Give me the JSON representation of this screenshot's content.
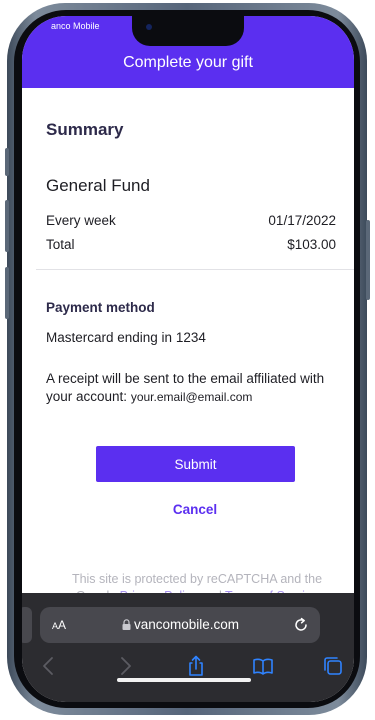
{
  "status_bar": {
    "app_name": "anco Mobile"
  },
  "header": {
    "title": "Complete your gift"
  },
  "summary": {
    "title": "Summary",
    "fund_name": "General Fund",
    "frequency_label": "Every week",
    "date": "01/17/2022",
    "total_label": "Total",
    "total_value": "$103.00"
  },
  "payment": {
    "title": "Payment method",
    "card_text": "Mastercard ending in 1234",
    "receipt_text": "A receipt will be sent to the email affiliated with your account:",
    "email": "your.email@email.com"
  },
  "actions": {
    "submit_label": "Submit",
    "cancel_label": "Cancel"
  },
  "recaptcha": {
    "text_before": "This site is protected by reCAPTCHA and the Google",
    "privacy_label": "Privacy Policy",
    "text_and": "and",
    "terms_label": "Terms of Service"
  },
  "browser": {
    "aa_small": "A",
    "aa_large": "A",
    "url": "vancomobile.com"
  },
  "icons": [
    "lock-icon",
    "reload-icon",
    "back-icon",
    "forward-icon",
    "share-icon",
    "bookmarks-icon",
    "tabs-icon"
  ],
  "colors": {
    "brand_purple": "#5b2ff0",
    "toolbar": "#2c2c30",
    "text": "#1e1e24"
  }
}
